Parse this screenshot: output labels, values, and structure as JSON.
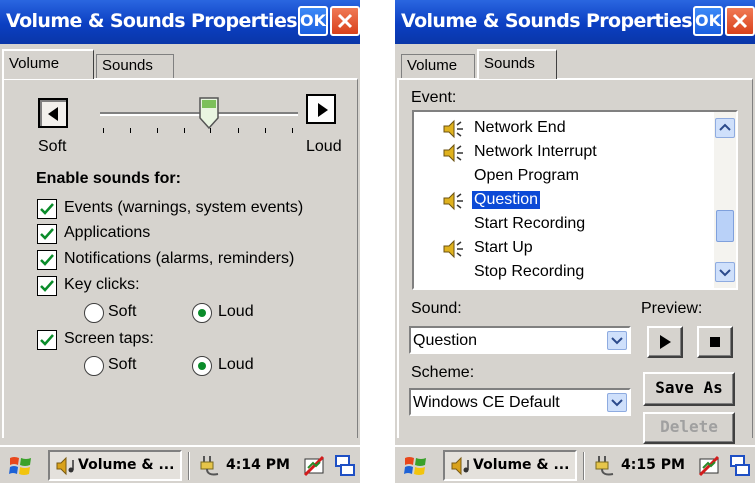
{
  "left": {
    "title": "Volume & Sounds Properties",
    "ok_label": "OK",
    "tabs": {
      "volume": "Volume",
      "sounds": "Sounds"
    },
    "slider": {
      "soft_label": "Soft",
      "loud_label": "Loud",
      "level": 0.56
    },
    "enable_heading": "Enable sounds for:",
    "checks": [
      {
        "label": "Events (warnings, system events)",
        "checked": true
      },
      {
        "label": "Applications",
        "checked": true
      },
      {
        "label": "Notifications (alarms, reminders)",
        "checked": true
      },
      {
        "label": "Key clicks:",
        "checked": true
      },
      {
        "label": "Screen taps:",
        "checked": true
      }
    ],
    "key_clicks": {
      "soft": "Soft",
      "loud": "Loud",
      "selected": "Loud"
    },
    "screen_taps": {
      "soft": "Soft",
      "loud": "Loud",
      "selected": "Loud"
    },
    "taskbar": {
      "task_label": "Volume & ...",
      "time": "4:14 PM"
    }
  },
  "right": {
    "title": "Volume & Sounds Properties",
    "ok_label": "OK",
    "tabs": {
      "volume": "Volume",
      "sounds": "Sounds"
    },
    "event_label": "Event:",
    "events": [
      {
        "label": "Network End",
        "icon": "speaker-icon"
      },
      {
        "label": "Network Interrupt",
        "icon": "speaker-icon"
      },
      {
        "label": "Open Program",
        "icon": ""
      },
      {
        "label": "Question",
        "icon": "speaker-icon",
        "selected": true
      },
      {
        "label": "Start Recording",
        "icon": ""
      },
      {
        "label": "Start Up",
        "icon": "speaker-icon"
      },
      {
        "label": "Stop Recording",
        "icon": ""
      }
    ],
    "sound_label": "Sound:",
    "sound_value": "Question",
    "preview_label": "Preview:",
    "scheme_label": "Scheme:",
    "scheme_value": "Windows CE Default",
    "save_as_label": "Save As",
    "delete_label": "Delete",
    "taskbar": {
      "task_label": "Volume & ...",
      "time": "4:15 PM"
    }
  }
}
